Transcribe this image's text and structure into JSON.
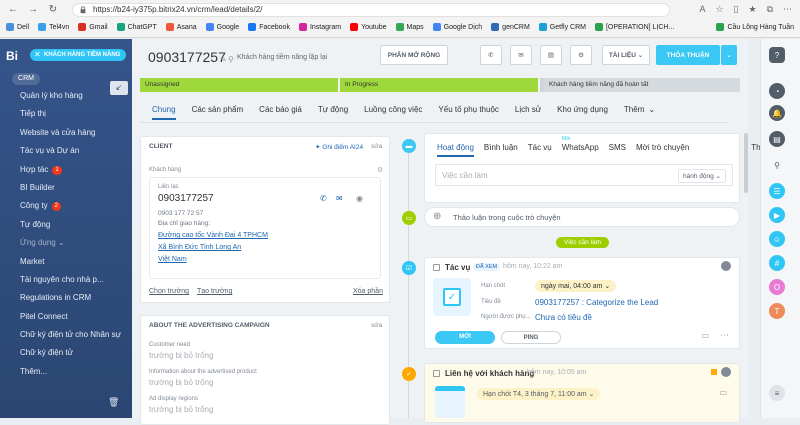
{
  "browser": {
    "url": "https://b24-iy375p.bitrix24.vn/crm/lead/details/2/",
    "bookmarks": [
      "Dell",
      "Tel4vn",
      "Gmail",
      "ChatGPT",
      "Asana",
      "Google",
      "Facebook",
      "Instagram",
      "Youtube",
      "Maps",
      "Google Dịch",
      "genCRM",
      "Getfly CRM",
      "[OPERATION] LỊCH...",
      "Cầu Lông Hàng Tuần"
    ],
    "bookmark_colors": [
      "#4a8fdc",
      "#37a0e6",
      "#d93025",
      "#19a37f",
      "#f0573b",
      "#4285f4",
      "#1877f2",
      "#d6249f",
      "#ff0000",
      "#34a853",
      "#4285f4",
      "#2e6db3",
      "#1f9fd8",
      "#2aa34b",
      "#2aa34b"
    ]
  },
  "sidebar": {
    "logo": "Bi",
    "lead_badge": "KHÁCH HÀNG TIỀM NĂNG",
    "section": "CRM",
    "items": [
      {
        "label": "Quản lý kho hàng",
        "dim": false
      },
      {
        "label": "Tiếp thị",
        "dim": false
      },
      {
        "label": "Website và cửa hàng",
        "dim": false
      },
      {
        "label": "Tác vụ và Dự án",
        "dim": false
      },
      {
        "label": "Hợp tác",
        "dim": false,
        "count": "1"
      },
      {
        "label": "BI Builder",
        "dim": false
      },
      {
        "label": "Công ty",
        "dim": false,
        "count": "2"
      },
      {
        "label": "Tự động",
        "dim": false
      },
      {
        "label": "Ứng dụng ⌄",
        "dim": true
      },
      {
        "label": "Market",
        "dim": false
      },
      {
        "label": "Tài nguyên cho nhà p...",
        "dim": false
      },
      {
        "label": "Regulations in CRM",
        "dim": false
      },
      {
        "label": "Pitel Connect",
        "dim": false
      },
      {
        "label": "Chữ ký điện tử cho Nhân sự",
        "dim": false
      },
      {
        "label": "Chữ ký điện tử",
        "dim": false
      },
      {
        "label": "Thêm...",
        "dim": false
      }
    ]
  },
  "header": {
    "title": "0903177257",
    "subtitle": "Khách hàng tiềm năng lặp lại",
    "btn_expand": "PHÂN MỞ RỘNG",
    "btn_docs": "TÀI LIỆU",
    "btn_deal": "THỎA THUẬN"
  },
  "stages": [
    {
      "label": "Unassigned",
      "color": "#9ed83a"
    },
    {
      "label": "In Progress",
      "color": "#9ed83a"
    },
    {
      "label": "",
      "color": "#cfd5d9"
    },
    {
      "label": "Khách hàng tiềm năng đã hoàn tất",
      "color": "#d5dade"
    }
  ],
  "tabs": [
    "Chung",
    "Các sản phẩm",
    "Các báo giá",
    "Tự động",
    "Luồng công việc",
    "Yếu tố phụ thuộc",
    "Lịch sử",
    "Kho ứng dụng",
    "Thêm"
  ],
  "client_card": {
    "title": "CLIENT",
    "ai": "Ghi điểm AI24",
    "edit": "sửa",
    "field_label": "Khách hàng",
    "contact_label": "Liên lạc",
    "name": "0903177257",
    "phone": "0903 177 72 57",
    "address_label": "Địa chỉ giao hàng:",
    "address": [
      "Đường cao tốc Vành Đai 4 TPHCM",
      "Xã Bình Đức Tỉnh Long An",
      "Việt Nam"
    ],
    "select_field": "Chọn trường",
    "create_field": "Tạo trường",
    "delete_section": "Xóa phần"
  },
  "ads_card": {
    "title": "ABOUT THE ADVERTISING CAMPAIGN",
    "edit": "sửa",
    "fields": [
      {
        "label": "Customer need",
        "value": "trường bị bỏ trống"
      },
      {
        "label": "Information about the advertised product",
        "value": "trường bị bỏ trống"
      },
      {
        "label": "Ad display regions",
        "value": "trường bị bỏ trống"
      }
    ]
  },
  "activity": {
    "tabs": [
      "Hoạt động",
      "Bình luận",
      "Tác vụ",
      "WhatsApp",
      "SMS",
      "Mời trò chuyện",
      "Thêm"
    ],
    "new_badge": "Mới",
    "placeholder": "Việc cần làm",
    "actions": "hành động",
    "discussion": "Thảo luận trong cuộc trò chuyện",
    "todo_pill": "Việc cần làm"
  },
  "task": {
    "kind": "Tác vụ",
    "badge": "ĐÃ XEM",
    "time": "hôm nay, 10:22 am",
    "deadline_label": "Hạn chót",
    "deadline": "ngày mai, 04:00 am",
    "title_label": "Tiêu đề",
    "title": "0903177257 : Categorize the Lead",
    "responsible_label": "Người được phụ...",
    "responsible": "Chưa có tiêu đề",
    "btn_new": "MỚI",
    "btn_ping": "PING"
  },
  "contact_item": {
    "title": "Liên hệ với khách hàng",
    "time": "hôm nay, 10:05 am",
    "deadline": "Hạn chót  T4, 3 tháng 7, 11:00 am"
  }
}
